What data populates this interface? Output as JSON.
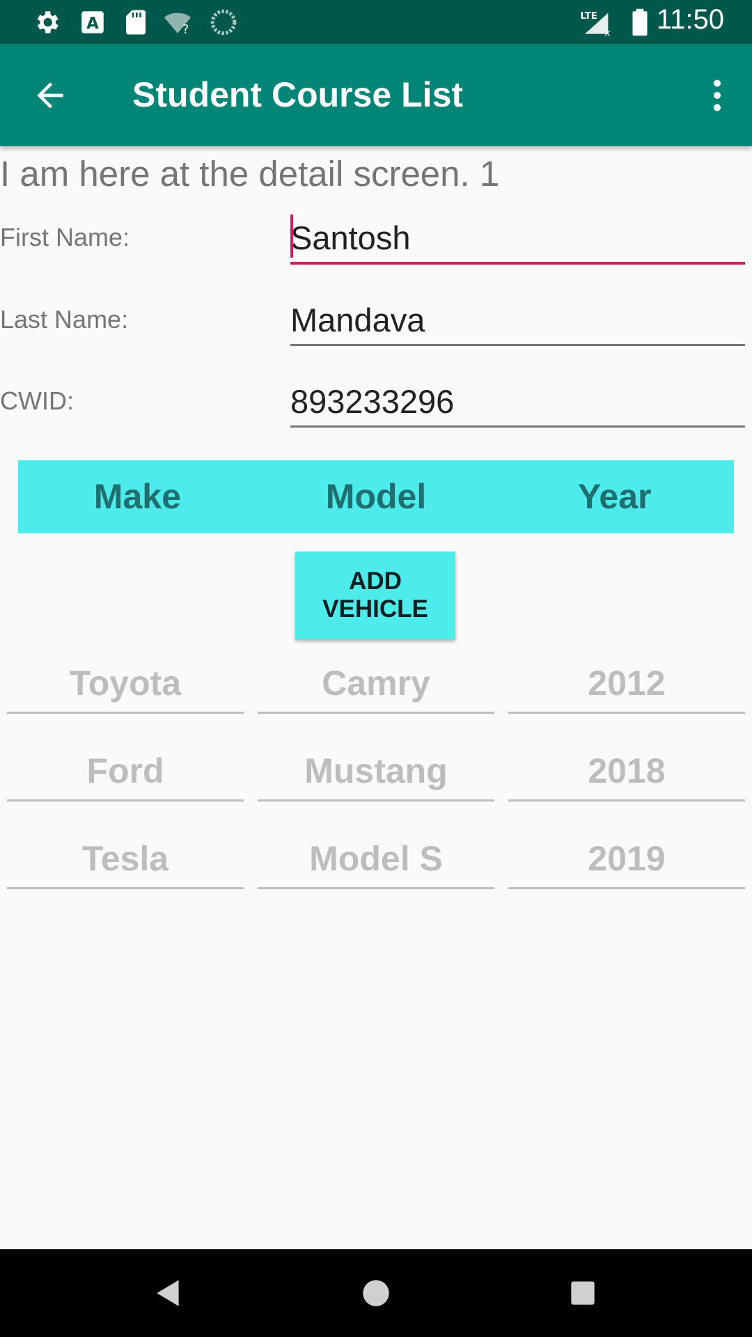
{
  "status_bar": {
    "time": "11:50",
    "icons": [
      "settings-icon",
      "a-notification-icon",
      "sd-card-icon",
      "wifi-unknown-icon",
      "sync-circle-icon",
      "lte-signal-icon",
      "battery-icon"
    ],
    "network_label": "LTE"
  },
  "app_bar": {
    "title": "Student Course List",
    "back_icon": "arrow-back-icon",
    "menu_icon": "more-vert-icon"
  },
  "detail": {
    "message": "I am here at the detail screen. 1",
    "first_name_label": "First Name:",
    "first_name_value": "Santosh",
    "last_name_label": "Last Name:",
    "last_name_value": "Mandava",
    "cwid_label": "CWID:",
    "cwid_value": "893233296"
  },
  "vehicle_table": {
    "headers": [
      "Make",
      "Model",
      "Year"
    ],
    "add_button_label": "ADD VEHICLE",
    "rows": [
      {
        "make": "Toyota",
        "model": "Camry",
        "year": "2012"
      },
      {
        "make": "Ford",
        "model": "Mustang",
        "year": "2018"
      },
      {
        "make": "Tesla",
        "model": "Model S",
        "year": "2019"
      }
    ]
  },
  "colors": {
    "status_bar": "#00574B",
    "app_bar": "#008577",
    "accent": "#D81B60",
    "header_bg": "#4DEBEB",
    "header_text": "#1F6F6F"
  },
  "nav_bar": {
    "buttons": [
      "back-triangle-icon",
      "home-circle-icon",
      "recents-square-icon"
    ]
  }
}
